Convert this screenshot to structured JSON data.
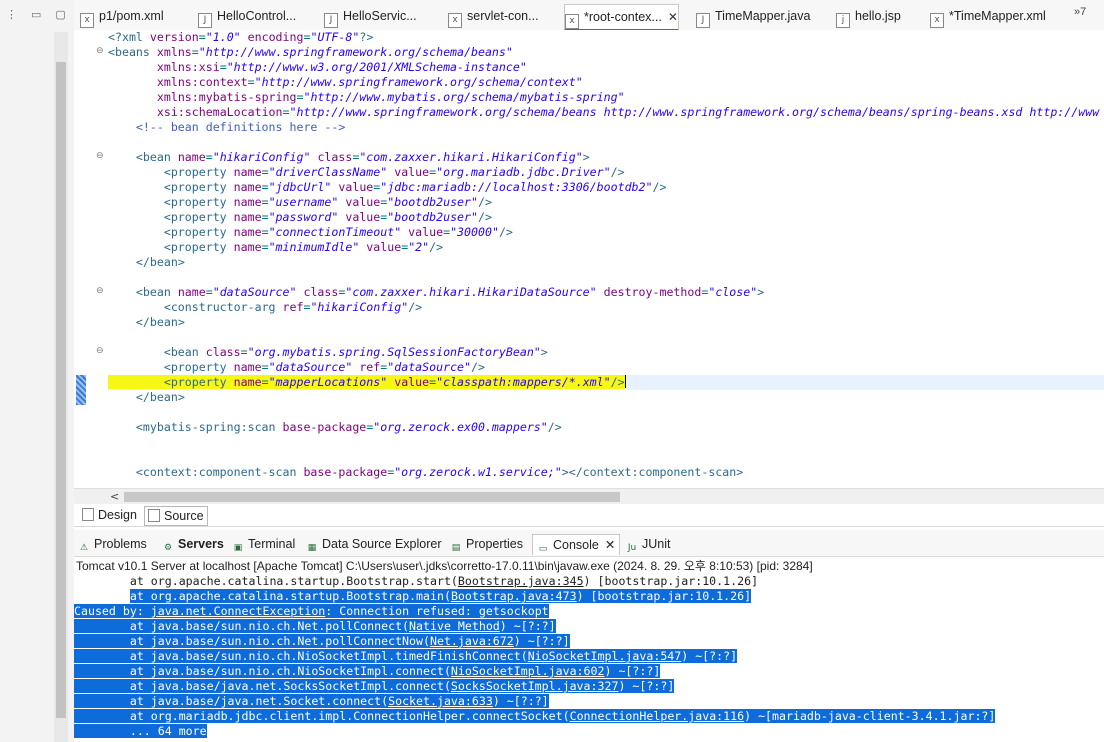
{
  "editor_tabs": [
    {
      "label": "p1/pom.xml",
      "icon": "xml-file-icon",
      "active": false
    },
    {
      "label": "HelloControl...",
      "icon": "java-file-icon",
      "active": false
    },
    {
      "label": "HelloServic...",
      "icon": "java-file-icon",
      "active": false
    },
    {
      "label": "servlet-con...",
      "icon": "xml-file-icon",
      "active": false
    },
    {
      "label": "*root-contex...",
      "icon": "xml-file-icon",
      "active": true
    },
    {
      "label": "TimeMapper.java",
      "icon": "java-file-icon",
      "active": false
    },
    {
      "label": "hello.jsp",
      "icon": "jsp-file-icon",
      "active": false
    },
    {
      "label": "*TimeMapper.xml",
      "icon": "xml-file-icon",
      "active": false
    }
  ],
  "editor_tabs_more": "»7",
  "code_lines": [
    "<?xml version=\"1.0\" encoding=\"UTF-8\"?>",
    "<beans xmlns=\"http://www.springframework.org/schema/beans\"",
    "       xmlns:xsi=\"http://www.w3.org/2001/XMLSchema-instance\"",
    "       xmlns:context=\"http://www.springframework.org/schema/context\"",
    "       xmlns:mybatis-spring=\"http://www.mybatis.org/schema/mybatis-spring\"",
    "       xsi:schemaLocation=\"http://www.springframework.org/schema/beans http://www.springframework.org/schema/beans/spring-beans.xsd http://www",
    "    <!-- bean definitions here -->",
    "",
    "    <bean name=\"hikariConfig\" class=\"com.zaxxer.hikari.HikariConfig\">",
    "        <property name=\"driverClassName\" value=\"org.mariadb.jdbc.Driver\"/>",
    "        <property name=\"jdbcUrl\" value=\"jdbc:mariadb://localhost:3306/bootdb2\"/>",
    "        <property name=\"username\" value=\"bootdb2user\"/>",
    "        <property name=\"password\" value=\"bootdb2user\"/>",
    "        <property name=\"connectionTimeout\" value=\"30000\"/>",
    "        <property name=\"minimumIdle\" value=\"2\"/>",
    "    </bean>",
    "",
    "    <bean name=\"dataSource\" class=\"com.zaxxer.hikari.HikariDataSource\" destroy-method=\"close\">",
    "        <constructor-arg ref=\"hikariConfig\"/>",
    "    </bean>",
    "",
    "        <bean class=\"org.mybatis.spring.SqlSessionFactoryBean\">",
    "        <property name=\"dataSource\" ref=\"dataSource\"/>",
    "        <property name=\"mapperLocations\" value=\"classpath:mappers/*.xml\"/>",
    "    </bean>",
    "",
    "    <mybatis-spring:scan base-package=\"org.zerock.ex00.mappers\"/>",
    "",
    "",
    "    <context:component-scan base-package=\"org.zerock.w1.service;\"></context:component-scan>"
  ],
  "subtabs": {
    "design": "Design",
    "source": "Source"
  },
  "panel_tabs": [
    {
      "label": "Problems",
      "icon": "problems-icon"
    },
    {
      "label": "Servers",
      "icon": "servers-icon"
    },
    {
      "label": "Terminal",
      "icon": "terminal-icon"
    },
    {
      "label": "Data Source Explorer",
      "icon": "data-source-icon"
    },
    {
      "label": "Properties",
      "icon": "properties-icon"
    },
    {
      "label": "Console",
      "icon": "console-icon"
    },
    {
      "label": "JUnit",
      "icon": "junit-icon"
    }
  ],
  "console_title": "Tomcat v10.1 Server at localhost [Apache Tomcat] C:\\Users\\user\\.jdks\\corretto-17.0.11\\bin\\javaw.exe  (2024. 8. 29. 오후 8:10:53) [pid: 3284]",
  "console_lines": [
    "        at org.apache.catalina.startup.Bootstrap.start(Bootstrap.java:345) [bootstrap.jar:10.1.26]",
    "        at org.apache.catalina.startup.Bootstrap.main(Bootstrap.java:473) [bootstrap.jar:10.1.26]",
    "Caused by: java.net.ConnectException: Connection refused: getsockopt",
    "        at java.base/sun.nio.ch.Net.pollConnect(Native Method) ~[?:?]",
    "        at java.base/sun.nio.ch.Net.pollConnectNow(Net.java:672) ~[?:?]",
    "        at java.base/sun.nio.ch.NioSocketImpl.timedFinishConnect(NioSocketImpl.java:547) ~[?:?]",
    "        at java.base/sun.nio.ch.NioSocketImpl.connect(NioSocketImpl.java:602) ~[?:?]",
    "        at java.base/java.net.SocksSocketImpl.connect(SocksSocketImpl.java:327) ~[?:?]",
    "        at java.base/java.net.Socket.connect(Socket.java:633) ~[?:?]",
    "        at org.mariadb.jdbc.client.impl.ConnectionHelper.connectSocket(ConnectionHelper.java:116) ~[mariadb-java-client-3.4.1.jar:?]",
    "        ... 64 more"
  ],
  "colors": {
    "selection": "#0d6cd9",
    "highlight": "#f7f716",
    "tag": "#2c6a8c",
    "attribute": "#7f007f",
    "value": "#2a00ff"
  }
}
